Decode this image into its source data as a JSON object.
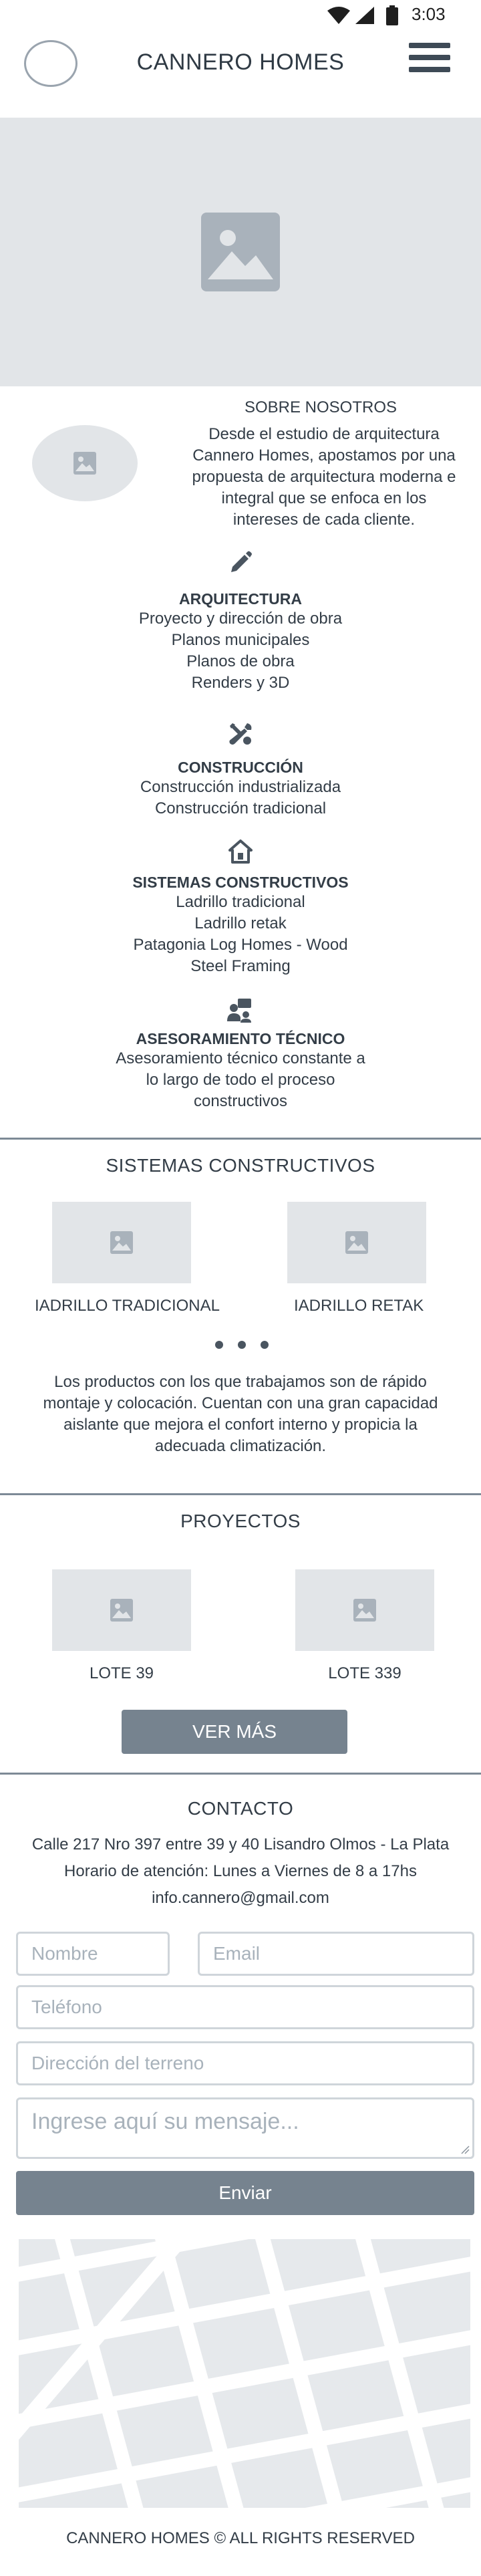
{
  "status_bar": {
    "time": "3:03"
  },
  "header": {
    "brand": "CANNERO HOMES"
  },
  "about": {
    "title": "SOBRE NOSOTROS",
    "lines": [
      "Desde el estudio de arquitectura",
      "Cannero Homes, apostamos por una",
      "propuesta de arquitectura moderna e",
      "integral que se enfoca en los",
      "intereses de cada cliente."
    ]
  },
  "services": [
    {
      "icon": "pencil-icon",
      "title": "ARQUITECTURA",
      "lines": [
        "Proyecto y dirección de obra",
        "Planos municipales",
        "Planos de obra",
        "Renders y 3D"
      ]
    },
    {
      "icon": "tools-icon",
      "title": "CONSTRUCCIÓN",
      "lines": [
        "Construcción industrializada",
        "Construcción tradicional"
      ]
    },
    {
      "icon": "house-icon",
      "title": "SISTEMAS CONSTRUCTIVOS",
      "lines": [
        "Ladrillo tradicional",
        "Ladrillo retak",
        "Patagonia Log Homes - Wood",
        "Steel Framing"
      ]
    },
    {
      "icon": "consulting-icon",
      "title": "ASESORAMIENTO TÉCNICO",
      "lines": [
        "Asesoramiento técnico constante a",
        "lo largo de todo el proceso",
        "constructivos"
      ]
    }
  ],
  "systems": {
    "title": "SISTEMAS CONSTRUCTIVOS",
    "items": [
      "IADRILLO TRADICIONAL",
      "IADRILLO RETAK"
    ],
    "description": [
      "Los productos con los que trabajamos son de rápido",
      "montaje y colocación. Cuentan con una gran capacidad",
      "aislante que mejora el confort interno y propicia la",
      "adecuada climatización."
    ]
  },
  "projects": {
    "title": "PROYECTOS",
    "items": [
      "LOTE 39",
      "LOTE 339"
    ],
    "more_button": "VER MÁS"
  },
  "contact": {
    "title": "CONTACTO",
    "address": "Calle 217 Nro 397 entre 39 y 40 Lisandro Olmos - La Plata",
    "hours": "Horario de atención: Lunes a Viernes de 8 a 17hs",
    "email": "info.cannero@gmail.com",
    "form": {
      "name_placeholder": "Nombre",
      "email_placeholder": "Email",
      "phone_placeholder": "Teléfono",
      "address_placeholder": "Dirección del terreno",
      "message_placeholder": "Ingrese aquí su mensaje...",
      "submit_label": "Enviar"
    }
  },
  "footer": {
    "copyright": "CANNERO HOMES © ALL RIGHTS RESERVED"
  },
  "colors": {
    "accent": "#76838f",
    "placeholder_bg": "#e2e5e8",
    "divider": "#7d8a96"
  }
}
